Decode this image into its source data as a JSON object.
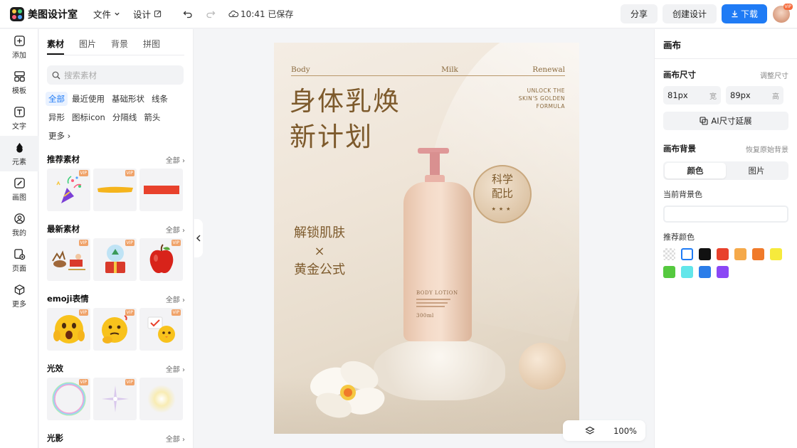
{
  "app": {
    "name": "美图设计室"
  },
  "menu": {
    "file": "文件",
    "design": "设计"
  },
  "status": {
    "saved": "10:41 已保存"
  },
  "actions": {
    "share": "分享",
    "create": "创建设计",
    "download": "下载",
    "avatar_badge": "VIP"
  },
  "rail": [
    {
      "icon": "plus-square-icon",
      "label": "添加"
    },
    {
      "icon": "template-icon",
      "label": "模板"
    },
    {
      "icon": "text-icon",
      "label": "文字"
    },
    {
      "icon": "elements-icon",
      "label": "元素"
    },
    {
      "icon": "draw-icon",
      "label": "画图"
    },
    {
      "icon": "user-icon",
      "label": "我的"
    },
    {
      "icon": "page-add-icon",
      "label": "页面"
    },
    {
      "icon": "cube-icon",
      "label": "更多"
    }
  ],
  "panel": {
    "tabs": [
      "素材",
      "图片",
      "背景",
      "拼图"
    ],
    "search_placeholder": "搜索素材",
    "chips": [
      "全部",
      "最近使用",
      "基础形状",
      "线条",
      "异形",
      "图标icon",
      "分隔线",
      "箭头",
      "更多"
    ],
    "sections": [
      {
        "title": "推荐素材",
        "all": "全部",
        "items": [
          "party-popper",
          "yellow-brush-stroke",
          "red-bar"
        ]
      },
      {
        "title": "最新素材",
        "all": "全部",
        "items": [
          "santa-sleigh",
          "snow-globe-gift",
          "red-apple"
        ]
      },
      {
        "title": "emoji表情",
        "all": "全部",
        "items": [
          "shocked-emoji",
          "thinking-emoji",
          "chick-emoji"
        ]
      },
      {
        "title": "光效",
        "all": "全部",
        "items": [
          "rainbow-bubble",
          "purple-sparkle",
          "yellow-glow"
        ]
      },
      {
        "title": "光影",
        "all": "全部",
        "items": []
      }
    ],
    "vip_label": "VIP"
  },
  "poster": {
    "top_left": "Body",
    "top_mid": "Milk",
    "top_right": "Renewal",
    "title_line1": "身体乳焕",
    "title_line2": "新计划",
    "eng_line1": "UNLOCK THE",
    "eng_line2": "SKIN'S GOLDEN",
    "eng_line3": "FORMULA",
    "seal_line1": "科学",
    "seal_line2": "配比",
    "seal_stars": "★★★",
    "sub_line1": "解锁肌肤",
    "sub_x": "×",
    "sub_line2": "黄金公式",
    "bottle_label": "BODY LOTION",
    "bottle_volume": "300ml"
  },
  "zoom": {
    "level": "100%"
  },
  "right_panel": {
    "title": "画布",
    "size_label": "画布尺寸",
    "size_adjust": "调整尺寸",
    "width_value": "81px",
    "width_unit": "宽",
    "height_value": "89px",
    "height_unit": "高",
    "ai_button": "AI尺寸延展",
    "bg_label": "画布背景",
    "bg_reset": "恢复原始背景",
    "seg_color": "颜色",
    "seg_image": "图片",
    "current_bg_label": "当前背景色",
    "recommend_label": "推荐颜色",
    "swatches": [
      "transparent",
      "#ffffff",
      "#111111",
      "#e8412c",
      "#f5a94a",
      "#f07a2a",
      "#f6ea3c",
      "#55c93f",
      "#62e6ea",
      "#2b7de9",
      "#8b47f5"
    ]
  }
}
